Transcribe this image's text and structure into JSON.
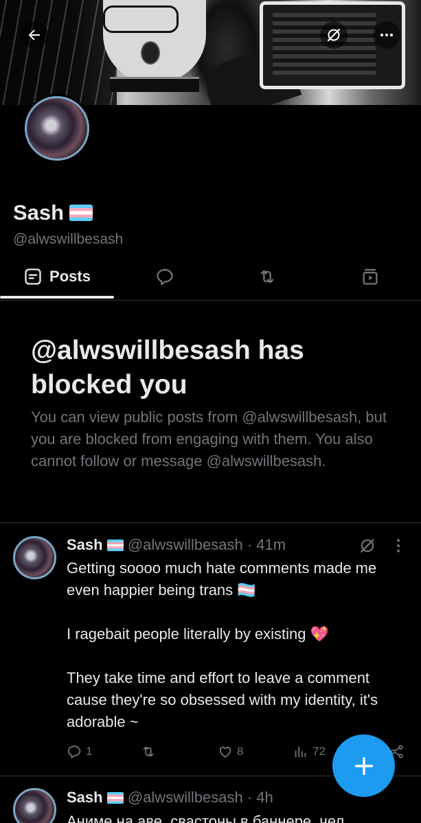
{
  "header": {
    "back_icon": "arrow-left-icon",
    "grok_icon": "grok-icon",
    "more_icon": "more-horizontal-icon"
  },
  "profile": {
    "display_name": "Sash",
    "flag_emoji": "🏳️‍⚧️",
    "handle": "@alwswillbesash"
  },
  "tabs": [
    {
      "label": "Posts",
      "icon": "posts-icon",
      "selected": true
    },
    {
      "label": "",
      "icon": "reply-bubble-icon",
      "selected": false
    },
    {
      "label": "",
      "icon": "repost-icon",
      "selected": false
    },
    {
      "label": "",
      "icon": "media-play-icon",
      "selected": false
    }
  ],
  "blocked": {
    "title": "@alwswillbesash has blocked you",
    "body": "You can view public posts from @alwswillbesash, but you are blocked from engaging with them. You also cannot follow or message @alwswillbesash."
  },
  "posts": [
    {
      "name": "Sash",
      "handle": "@alwswillbesash",
      "time": "· 41m",
      "paragraphs": [
        "Getting soooo much hate comments made me even happier being trans 🏳️‍⚧️",
        "I ragebait people literally by existing 💖",
        "They take time and effort to leave a comment cause they're so obsessed with my identity, it's adorable ~"
      ],
      "replies": "1",
      "reposts": "",
      "likes": "8",
      "views": "72"
    },
    {
      "name": "Sash",
      "handle": "@alwswillbesash",
      "time": "· 4h",
      "paragraphs": [
        "Аниме на аве, свастоны в баннере, чел"
      ]
    }
  ],
  "fab": {
    "icon": "plus-icon",
    "color": "#1d9bf0"
  },
  "colors": {
    "accent": "#1d9bf0",
    "muted": "#71767b",
    "text": "#e7e9ea",
    "background": "#000000"
  }
}
